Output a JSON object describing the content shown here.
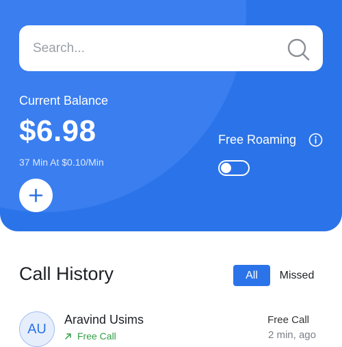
{
  "search": {
    "placeholder": "Search..."
  },
  "balance": {
    "label": "Current Balance",
    "amount": "$6.98",
    "rate": "37 Min At $0.10/Min"
  },
  "roaming": {
    "label": "Free Roaming",
    "enabled": false
  },
  "history": {
    "title": "Call History",
    "filters": {
      "all": "All",
      "missed": "Missed",
      "active": "All"
    },
    "calls": [
      {
        "initials": "AU",
        "name": "Aravind Usims",
        "status": "Free Call",
        "type": "Free Call",
        "time": "2 min, ago"
      }
    ]
  },
  "colors": {
    "primary": "#2b73e8",
    "success": "#2f9e44"
  },
  "icons": [
    "search-icon",
    "plus-icon",
    "info-icon",
    "outgoing-arrow-icon"
  ]
}
